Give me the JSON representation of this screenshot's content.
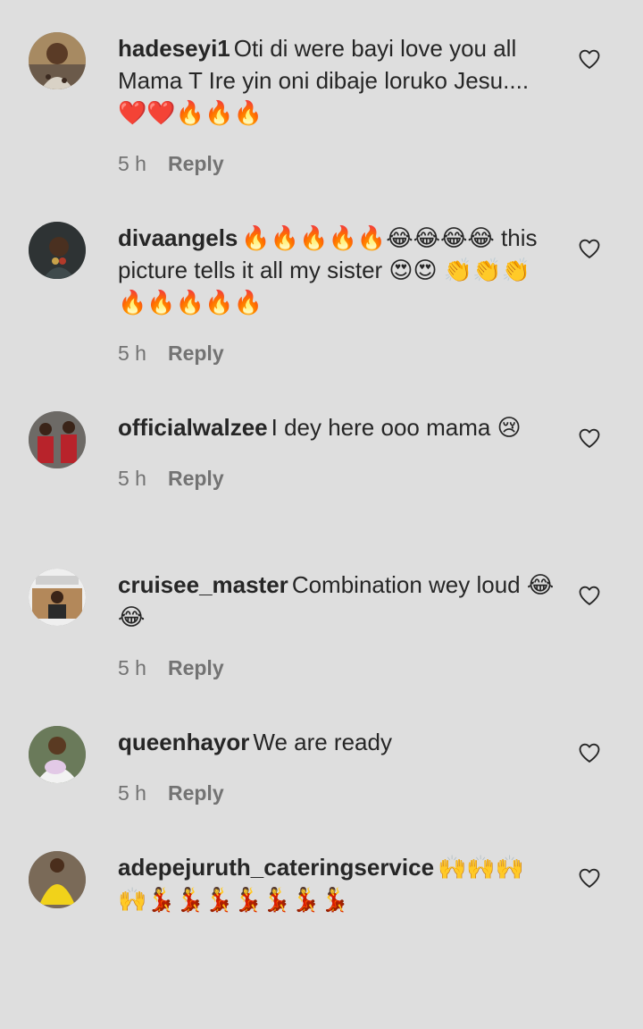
{
  "comments": [
    {
      "username": "hadeseyi1",
      "text": "Oti di were bayi love you all Mama T Ire yin oni dibaje loruko Jesu....❤️❤️🔥🔥🔥",
      "time": "5 h",
      "reply_label": "Reply"
    },
    {
      "username": "divaangels",
      "text": "🔥🔥🔥🔥🔥😂😂😂😂 this picture tells it all my sister 😍😍 👏👏👏🔥🔥🔥🔥🔥",
      "time": "5 h",
      "reply_label": "Reply"
    },
    {
      "username": "officialwalzee",
      "text": "I dey here ooo mama 😢",
      "time": "5 h",
      "reply_label": "Reply"
    },
    {
      "username": "cruisee_master",
      "text": "Combination wey loud 😂😂",
      "time": "5 h",
      "reply_label": "Reply"
    },
    {
      "username": "queenhayor",
      "text": "We are ready",
      "time": "5 h",
      "reply_label": "Reply"
    },
    {
      "username": "adepejuruth_cateringservice",
      "text": "🙌🙌🙌 🙌💃💃💃💃💃💃💃",
      "time": "",
      "reply_label": ""
    }
  ],
  "icons": {
    "like": "heart-outline-icon"
  },
  "colors": {
    "background": "#dedede",
    "text": "#262626",
    "secondary_text": "#737373"
  }
}
